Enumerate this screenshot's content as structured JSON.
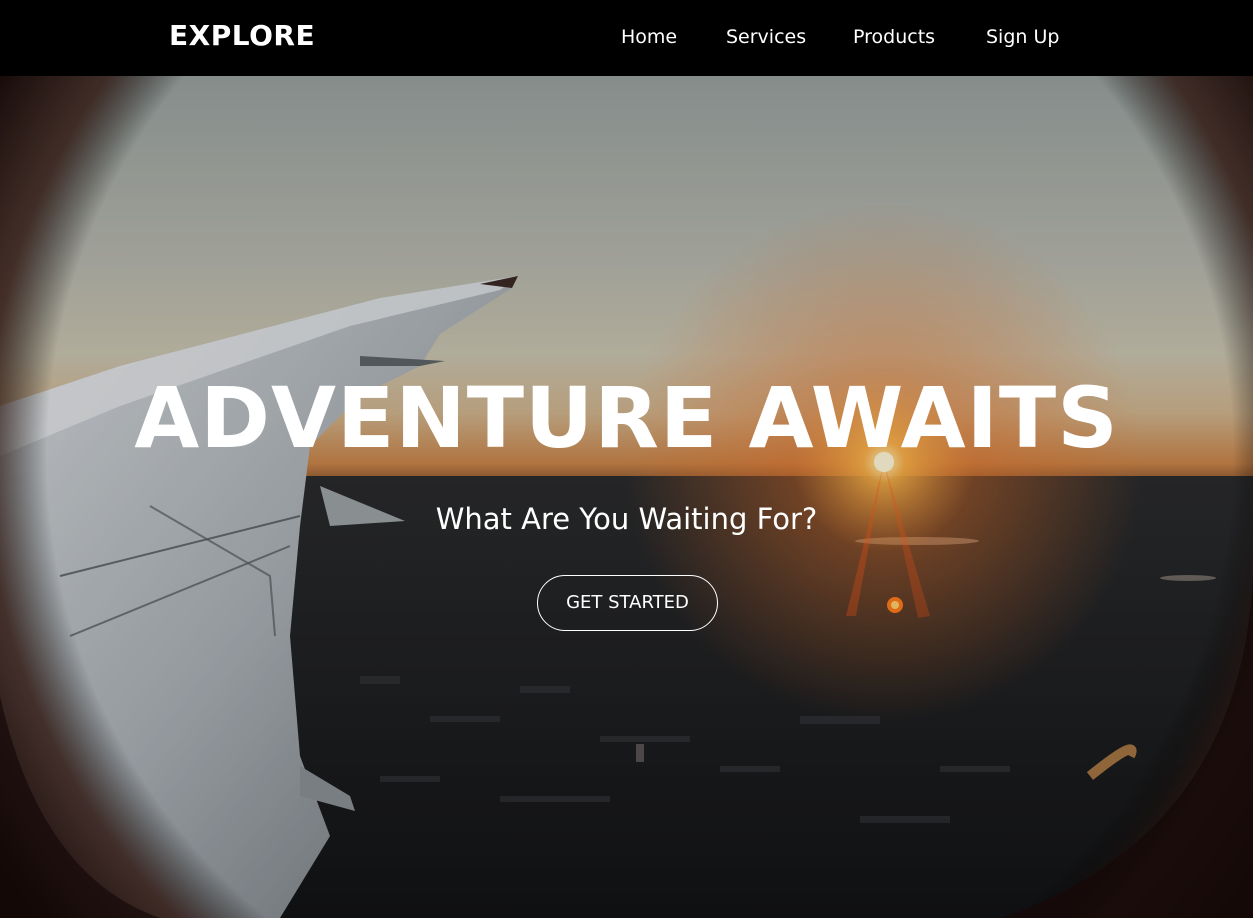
{
  "navbar": {
    "logo": "EXPLORE",
    "links": [
      {
        "label": "Home"
      },
      {
        "label": "Services"
      },
      {
        "label": "Products"
      },
      {
        "label": "Sign Up"
      }
    ]
  },
  "hero": {
    "title": "ADVENTURE AWAITS",
    "subtitle": "What Are You Waiting For?",
    "button_label": "GET STARTED",
    "background_image": "airplane-wing-sunset-photo"
  },
  "colors": {
    "nav_background": "#000000",
    "text": "#ffffff",
    "sunset_orange": "#e8752a"
  }
}
